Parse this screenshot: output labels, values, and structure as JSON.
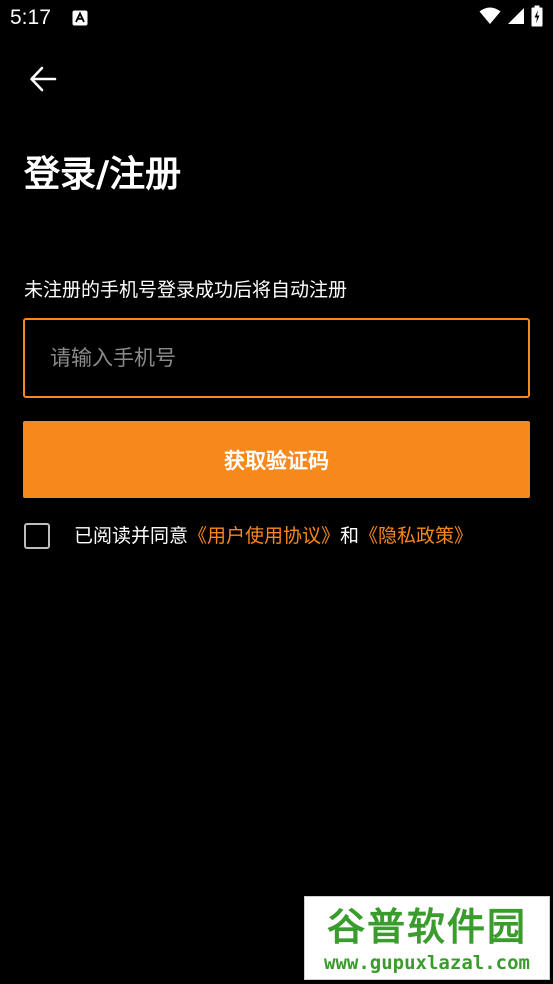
{
  "status_bar": {
    "time": "5:17",
    "icons": [
      "notification-a-icon",
      "wifi-icon",
      "signal-icon",
      "battery-charging-icon"
    ]
  },
  "header": {
    "back_icon": "arrow-left-icon",
    "title": "登录/注册"
  },
  "form": {
    "hint": "未注册的手机号登录成功后将自动注册",
    "phone_placeholder": "请输入手机号",
    "phone_value": "",
    "get_code_label": "获取验证码"
  },
  "agreement": {
    "checked": false,
    "prefix": "已阅读并同意",
    "user_agreement_link": "《用户使用协议》",
    "conjunction": "和",
    "privacy_link": "《隐私政策》"
  },
  "watermark": {
    "title": "谷普软件园",
    "url": "www.gupuxlazal.com"
  },
  "colors": {
    "background": "#000000",
    "accent": "#f7881c",
    "text": "#ffffff",
    "placeholder": "#8a8a8a",
    "watermark_green": "#3a9c2c"
  }
}
